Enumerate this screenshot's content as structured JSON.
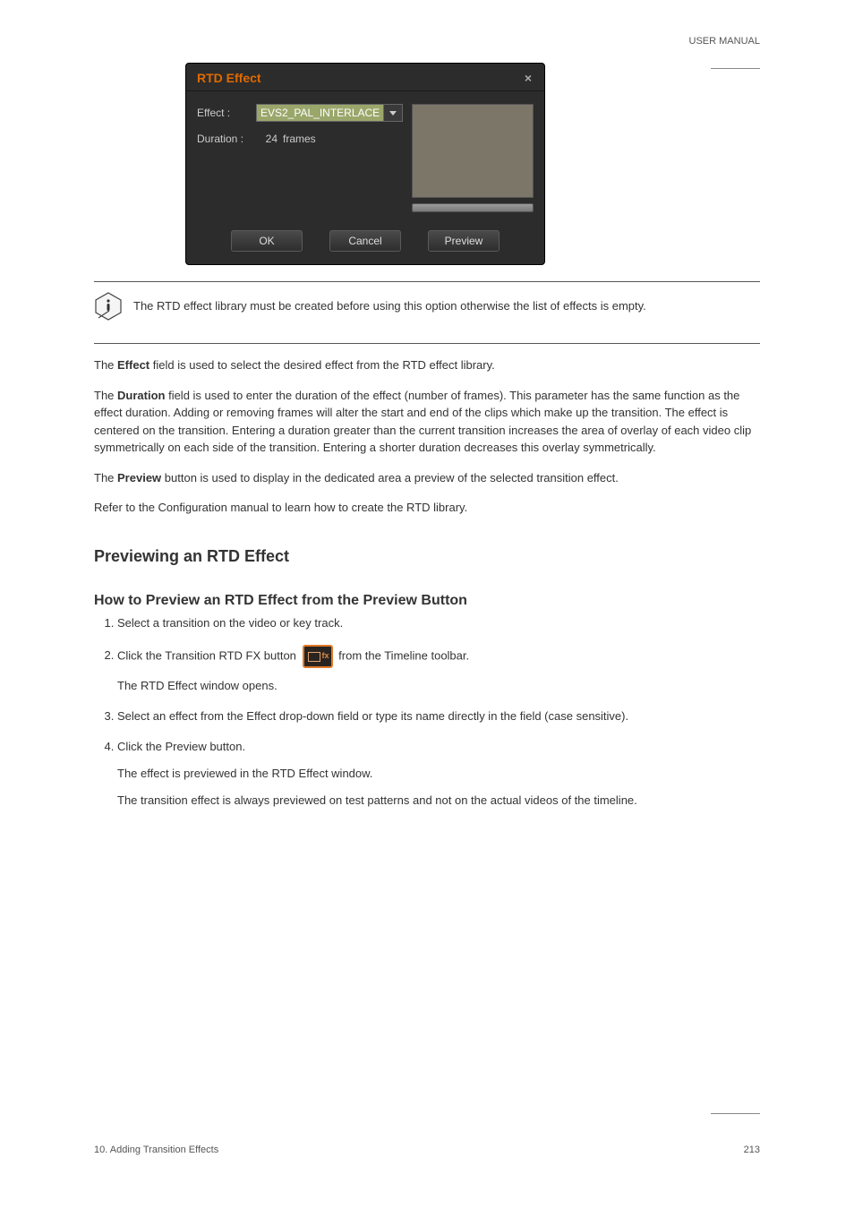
{
  "header": {
    "text": "USER MANUAL"
  },
  "dialog": {
    "title": "RTD Effect",
    "effect_label": "Effect :",
    "effect_value": "EVS2_PAL_INTERLACE",
    "duration_label": "Duration :",
    "duration_value": "24",
    "duration_unit": "frames",
    "buttons": {
      "ok": "OK",
      "cancel": "Cancel",
      "preview": "Preview"
    }
  },
  "note": {
    "text": "The RTD effect library must be created before using this option otherwise the list of effects is empty."
  },
  "paragraphs": {
    "p1_part1": "The ",
    "p1_bold1": "Effect",
    "p1_part2": " field is used to select the desired effect from the RTD effect library.",
    "p2_part1": "The ",
    "p2_bold1": "Duration",
    "p2_part2": " field is used to enter the duration of the effect (number of frames). This parameter has the same function as the effect duration. Adding or removing frames will alter the start and end of the clips which make up the transition. The effect is centered on the transition. Entering a duration greater than the current transition increases the area of overlay of each video clip symmetrically on each side of the transition. Entering a shorter duration decreases this overlay symmetrically.",
    "p3_part1": "The ",
    "p3_bold1": "Preview",
    "p3_part2": " button is used to display in the dedicated area a preview of the selected transition effect.",
    "p4": "Refer to the Configuration manual to learn how to create the RTD library."
  },
  "headings": {
    "h2": "Previewing an RTD Effect",
    "h3": "How to Preview an RTD Effect from the Preview Button"
  },
  "steps": {
    "s1": "Select a transition on the video or key track.",
    "s2_part1": "Click the ",
    "s2_bold1": "Transition RTD FX",
    "s2_part2": " button ",
    "s2_part3": " from the Timeline toolbar.",
    "s2_sub": "The RTD Effect window opens.",
    "s3_part1": "Select an effect from the ",
    "s3_bold1": "Effect",
    "s3_part2": " drop-down field or type its name directly in the field (case sensitive).",
    "s4_part1": "Click the ",
    "s4_bold1": "Preview",
    "s4_part2": " button.",
    "s4_sub1": "The effect is previewed in the RTD Effect window.",
    "s4_sub2": "The transition effect is always previewed on test patterns and not on the actual videos of the timeline."
  },
  "footer": {
    "left": "10. Adding Transition Effects",
    "right": "213"
  }
}
